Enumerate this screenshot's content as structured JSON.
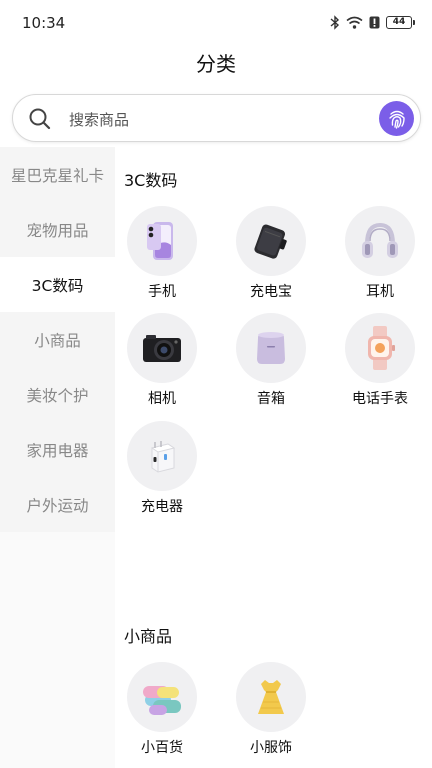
{
  "status_bar": {
    "time": "10:34",
    "battery": "44"
  },
  "header": {
    "title": "分类"
  },
  "search": {
    "placeholder": "搜索商品"
  },
  "sidebar": {
    "items": [
      {
        "label": "星巴克星礼卡"
      },
      {
        "label": "宠物用品"
      },
      {
        "label": "3C数码"
      },
      {
        "label": "小商品"
      },
      {
        "label": "美妆个护"
      },
      {
        "label": "家用电器"
      },
      {
        "label": "户外运动"
      }
    ],
    "active": "3C数码"
  },
  "sections": [
    {
      "title": "3C数码",
      "items": [
        {
          "label": "手机",
          "icon": "phone-icon"
        },
        {
          "label": "充电宝",
          "icon": "power-bank-icon"
        },
        {
          "label": "耳机",
          "icon": "headphones-icon"
        },
        {
          "label": "相机",
          "icon": "camera-icon"
        },
        {
          "label": "音箱",
          "icon": "speaker-icon"
        },
        {
          "label": "电话手表",
          "icon": "smartwatch-icon"
        },
        {
          "label": "充电器",
          "icon": "charger-icon"
        }
      ]
    },
    {
      "title": "小商品",
      "items": [
        {
          "label": "小百货",
          "icon": "towels-icon"
        },
        {
          "label": "小服饰",
          "icon": "dress-icon"
        }
      ]
    }
  ],
  "colors": {
    "accent": "#7b5ee8",
    "sidebar_bg": "#f5f5f5",
    "active_bg": "#ffffff"
  }
}
